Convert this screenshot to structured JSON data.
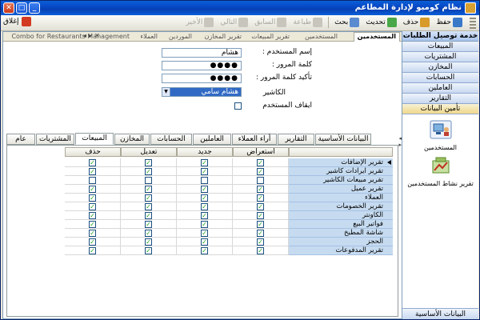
{
  "window": {
    "title": "نظام كومبو لإدارة المطاعم"
  },
  "toolbar": {
    "items": [
      {
        "label": "حفظ",
        "disabled": false
      },
      {
        "label": "حذف",
        "disabled": false
      },
      {
        "label": "تحديث",
        "disabled": false
      },
      {
        "label": "بحث",
        "disabled": false
      },
      {
        "label": "طباعة",
        "disabled": true
      },
      {
        "label": "السابق",
        "disabled": true
      },
      {
        "label": "التالي",
        "disabled": true
      },
      {
        "label": "الأخير",
        "disabled": true
      }
    ],
    "close_label": "إغلاق"
  },
  "nav": {
    "header": "خدمة توصيل الطلبات",
    "items": [
      "المبيعات",
      "المشتريات",
      "المخازن",
      "الحسابات",
      "العاملين",
      "التقارير",
      "تأمين البيانات"
    ],
    "tiles": [
      {
        "label": "المستخدمين"
      },
      {
        "label": "تقرير نشاط المستخدمين"
      }
    ],
    "footer": "البيانات الأساسية"
  },
  "doc_tabs": {
    "active": "المستخدمين",
    "others": [
      "المستخدمين",
      "تقرير المبيعات",
      "تقرير المخازن",
      "الموردين",
      "العملاء",
      "Combo for Restaurants Management"
    ]
  },
  "form": {
    "username_label": "إسم المستخدم :",
    "username_value": "هشام",
    "password_label": "كلمة المرور :",
    "password_value": "●●●●",
    "confirm_label": "تأكيد كلمة المرور :",
    "confirm_value": "●●●●",
    "cashier_label": "الكاشير",
    "cashier_value": "هشام سامي",
    "suspend_label": "ايقاف المستخدم"
  },
  "sub_tabs": [
    "عام",
    "المشتريات",
    "المبيعات",
    "المخازن",
    "الحسابات",
    "العاملين",
    "أراء العملاء",
    "التقارير",
    "البيانات الأساسية"
  ],
  "sub_tabs_active": "المبيعات",
  "grid": {
    "columns": [
      "استعراض",
      "جديد",
      "تعديل",
      "حذف"
    ],
    "rows": [
      {
        "name": "تقرير الإضافات",
        "v": [
          true,
          true,
          true,
          true
        ]
      },
      {
        "name": "تقرير ايرادات كاشير",
        "v": [
          true,
          true,
          true,
          true
        ]
      },
      {
        "name": "تقرير مبيعات الكاشير",
        "v": [
          false,
          false,
          false,
          false
        ]
      },
      {
        "name": "تقرير عميل",
        "v": [
          true,
          true,
          true,
          true
        ]
      },
      {
        "name": "العملاء",
        "v": [
          true,
          true,
          true,
          true
        ]
      },
      {
        "name": "تقرير الخصومات",
        "v": [
          true,
          true,
          true,
          true
        ]
      },
      {
        "name": "الكاونتر",
        "v": [
          true,
          true,
          true,
          true
        ]
      },
      {
        "name": "فواتير البيع",
        "v": [
          true,
          true,
          true,
          true
        ]
      },
      {
        "name": "شاشة المطبخ",
        "v": [
          true,
          true,
          true,
          true
        ]
      },
      {
        "name": "الحجز",
        "v": [
          true,
          true,
          true,
          true
        ]
      },
      {
        "name": "تقرير المدفوعات",
        "v": [
          true,
          true,
          true,
          true
        ]
      }
    ]
  }
}
